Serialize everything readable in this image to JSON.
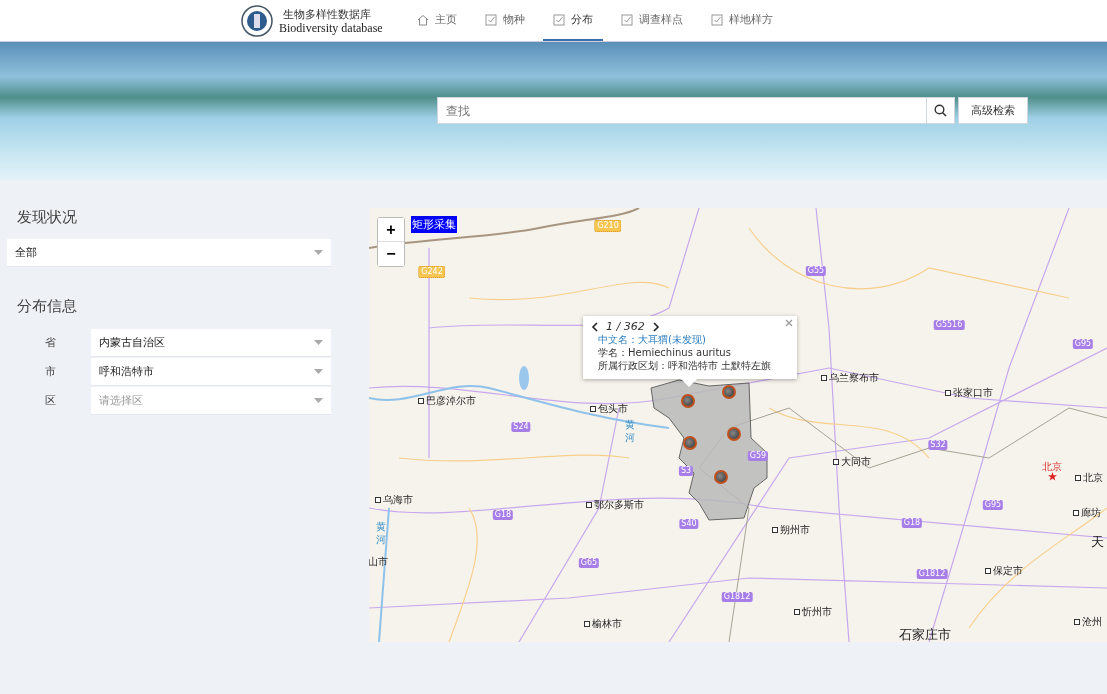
{
  "header": {
    "logo_title": "生物多样性数据库",
    "logo_subtitle": "Biodiversity database",
    "nav": [
      {
        "label": "主页",
        "kind": "home",
        "selected": false
      },
      {
        "label": "物种",
        "kind": "check",
        "selected": false
      },
      {
        "label": "分布",
        "kind": "check",
        "selected": true
      },
      {
        "label": "调查样点",
        "kind": "check",
        "selected": false
      },
      {
        "label": "样地样方",
        "kind": "check",
        "selected": false
      }
    ]
  },
  "banner": {
    "search": {
      "placeholder": "查找"
    },
    "advanced_button": "高级检索"
  },
  "sidebar": {
    "discovery": {
      "title": "发现状况",
      "value": "全部"
    },
    "distribution": {
      "title": "分布信息",
      "fields": [
        {
          "label": "省",
          "value": "内蒙古自治区"
        },
        {
          "label": "市",
          "value": "呼和浩特市"
        },
        {
          "label": "区",
          "placeholder": "请选择区"
        }
      ]
    }
  },
  "map": {
    "zoom_in": "+",
    "zoom_out": "−",
    "rect_tool": "矩形采集",
    "popup": {
      "pager": "1 / 362",
      "name": "中文名：大耳猬(未发现)",
      "latin": "学名：Hemiechinus auritus",
      "region": "所属行政区划：呼和浩特市 土默特左旗"
    },
    "cities": [
      {
        "name": "巴彦淖尔市",
        "kind": "city"
      },
      {
        "name": "包头市",
        "kind": "city"
      },
      {
        "name": "乌兰察布市",
        "kind": "city"
      },
      {
        "name": "张家口市",
        "kind": "city"
      },
      {
        "name": "大同市",
        "kind": "city"
      },
      {
        "name": "北京",
        "kind": "capital"
      },
      {
        "name": "北京",
        "kind": "city"
      },
      {
        "name": "乌海市",
        "kind": "city"
      },
      {
        "name": "鄂尔多斯市",
        "kind": "city"
      },
      {
        "name": "朔州市",
        "kind": "city"
      },
      {
        "name": "廊坊",
        "kind": "city"
      },
      {
        "name": "天",
        "kind": "large"
      },
      {
        "name": "石家庄市",
        "kind": "large"
      },
      {
        "name": "保定市",
        "kind": "city"
      },
      {
        "name": "忻州市",
        "kind": "city"
      },
      {
        "name": "榆林市",
        "kind": "city"
      },
      {
        "name": "沧州",
        "kind": "city"
      },
      {
        "name": "山市",
        "kind": "plain"
      }
    ],
    "rivers": [
      "黄河",
      "黄河"
    ],
    "roads": [
      {
        "label": "G210",
        "kind": "national"
      },
      {
        "label": "G242",
        "kind": "national"
      },
      {
        "label": "G55",
        "kind": "expressway"
      },
      {
        "label": "G5516",
        "kind": "expressway"
      },
      {
        "label": "G95",
        "kind": "expressway"
      },
      {
        "label": "S24",
        "kind": "expressway"
      },
      {
        "label": "S3",
        "kind": "expressway"
      },
      {
        "label": "G59",
        "kind": "expressway"
      },
      {
        "label": "S32",
        "kind": "expressway"
      },
      {
        "label": "G18",
        "kind": "expressway"
      },
      {
        "label": "S40",
        "kind": "expressway"
      },
      {
        "label": "G65",
        "kind": "expressway"
      },
      {
        "label": "G18",
        "kind": "expressway"
      },
      {
        "label": "G1812",
        "kind": "expressway"
      },
      {
        "label": "G1812",
        "kind": "expressway"
      },
      {
        "label": "G95",
        "kind": "expressway"
      }
    ]
  }
}
